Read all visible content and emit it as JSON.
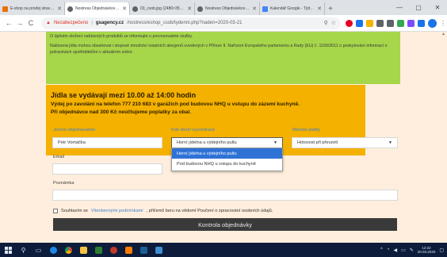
{
  "browser": {
    "tabs": [
      {
        "title": "E-shop na prodej stravy a n",
        "favicon_color": "#e8710a",
        "active": false
      },
      {
        "title": "Nostress Objednávkový sy",
        "favicon_color": "#5f6368",
        "active": true
      },
      {
        "title": "03_csob.jpg (2480×3508)",
        "favicon_color": "#5f6368",
        "active": false
      },
      {
        "title": "Nostress Objednávkový sy",
        "favicon_color": "#5f6368",
        "active": false
      },
      {
        "title": "Kalendář Google - Týden o",
        "favicon_color": "#4285f4",
        "active": false
      }
    ],
    "new_tab": "+",
    "window_controls": [
      "—",
      "▢",
      "✕"
    ],
    "nav": {
      "back": "←",
      "forward": "→",
      "reload": "C"
    },
    "address": {
      "warning": "Nezabezpečeno",
      "separator": "|",
      "host": "gsagency.cz",
      "path": "/nostress/eshop_csob/tydenni.php?naden=2020-03-21"
    }
  },
  "page": {
    "allergen_info": [
      "O úplném složení nabízených produktů se informujte u provozovatele služby.",
      "Nabízená jídla mohou obsahovat i stopové množství ostatních alergenů uvedených v Příloze II. Nařízení Evropského parlamentu a Rady (EU) č. 1169/2011 o poskytování informací o potravinách spotřebitelům v aktuálním znění."
    ],
    "notice": {
      "title": "Jídla se vydávají mezi 10.00 až 14:00 hodin",
      "line1": "Výdej po zavolání na telefon 777 210 683 v garážích pod budovou NHQ u vstupu do zázemí kuchyně.",
      "line2": "Při objednávce nad 300 Kč neúčtujeme poplatky za obal."
    },
    "form": {
      "name_label": "Jméno objednavatele",
      "name_value": "Petr Vomáčka",
      "pickup_label": "Kde zboží vyzvednout",
      "pickup_value": "Horní jídelna u výdejního pultu",
      "pickup_options": [
        "Horní jídelna u výdejního pultu",
        "Pod budovou NHQ u vstupu do kuchyně"
      ],
      "payment_label": "Metoda platby",
      "payment_value": "Hotovost při převzetí",
      "email_label": "Email",
      "email_value": "",
      "note_label": "Poznámka",
      "note_value": "",
      "consent_prefix": "Souhlasím se",
      "consent_link": "Všeobecnými podmínkami",
      "consent_suffix": ", přičemž beru na vědomí Poučení o zpracování osobních údajů.",
      "submit": "Kontrola objednávky"
    }
  },
  "taskbar": {
    "clock_time": "12:22",
    "clock_date": "20.03.2020"
  }
}
